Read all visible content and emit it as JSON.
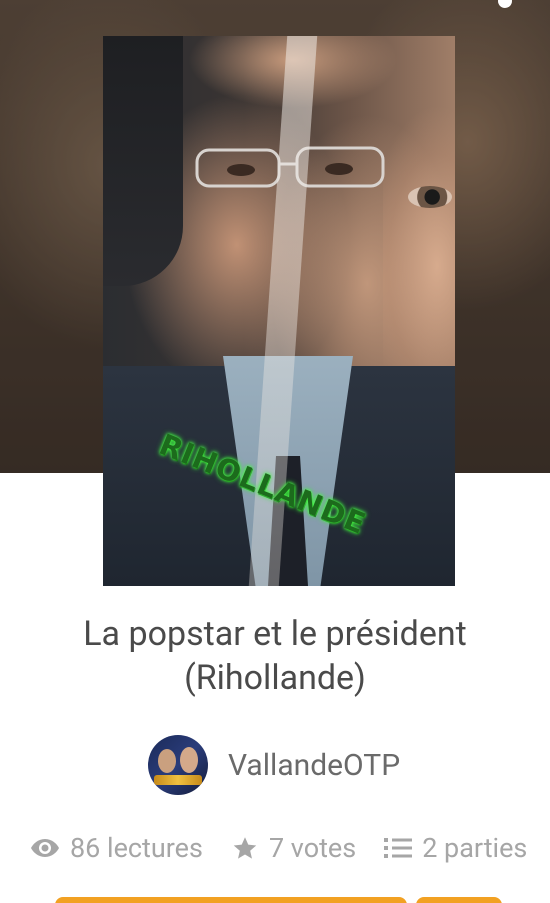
{
  "story": {
    "cover_text": "RIHOLLANDE",
    "title_line1": "La popstar et le président",
    "title_line2": "(Rihollande)"
  },
  "author": {
    "name": "VallandeOTP"
  },
  "stats": {
    "reads": "86 lectures",
    "votes": "7 votes",
    "parts": "2 parties"
  },
  "icons": {
    "reads": "eye-icon",
    "votes": "star-icon",
    "parts": "list-icon"
  },
  "colors": {
    "accent": "#f2a122",
    "cover_text_glow": "#4dff4d",
    "title_text": "#4a4a4a",
    "stats_text": "#a6a6a6"
  }
}
